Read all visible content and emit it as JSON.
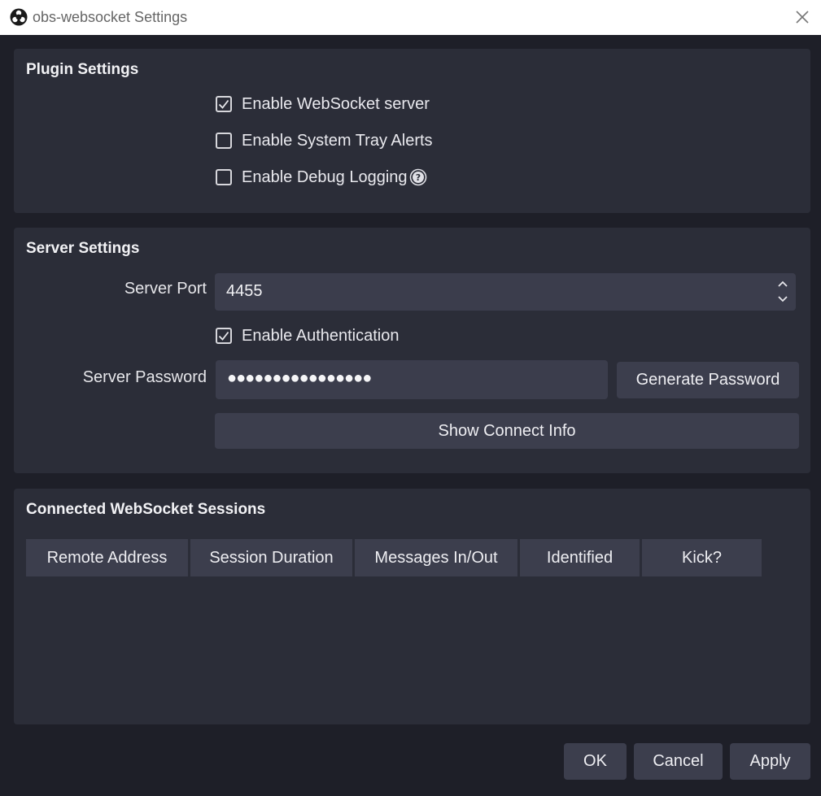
{
  "window": {
    "title": "obs-websocket Settings"
  },
  "plugin_settings": {
    "title": "Plugin Settings",
    "enable_server": {
      "label": "Enable WebSocket server",
      "checked": true
    },
    "enable_tray_alerts": {
      "label": "Enable System Tray Alerts",
      "checked": false
    },
    "enable_debug_logging": {
      "label": "Enable Debug Logging",
      "checked": false
    }
  },
  "server_settings": {
    "title": "Server Settings",
    "port_label": "Server Port",
    "port_value": "4455",
    "enable_auth": {
      "label": "Enable Authentication",
      "checked": true
    },
    "password_label": "Server Password",
    "password_mask": "●●●●●●●●●●●●●●●●",
    "generate_password_label": "Generate Password",
    "show_connect_info_label": "Show Connect Info"
  },
  "sessions": {
    "title": "Connected WebSocket Sessions",
    "columns": [
      "Remote Address",
      "Session Duration",
      "Messages In/Out",
      "Identified",
      "Kick?"
    ]
  },
  "footer": {
    "ok_label": "OK",
    "cancel_label": "Cancel",
    "apply_label": "Apply"
  },
  "icons": {
    "app": "obs-logo-icon",
    "close": "close-icon",
    "check": "check-icon",
    "help": "help-icon",
    "spin_up": "chevron-up-icon",
    "spin_down": "chevron-down-icon"
  }
}
